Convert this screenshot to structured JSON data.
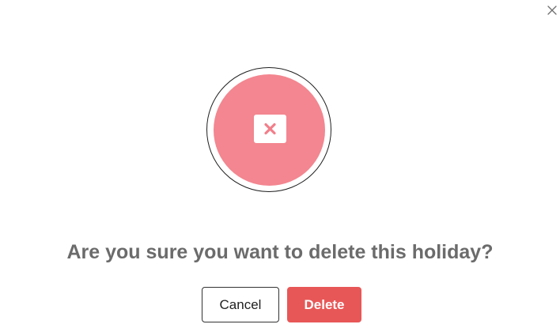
{
  "dialog": {
    "message": "Are you sure you want to delete this holiday?",
    "cancel_label": "Cancel",
    "delete_label": "Delete",
    "close_icon": "close-icon",
    "hero_icon": "delete-x-icon"
  },
  "colors": {
    "accent_disc": "#f38690",
    "danger_button": "#e85757",
    "message_text": "#6b6b6b"
  }
}
